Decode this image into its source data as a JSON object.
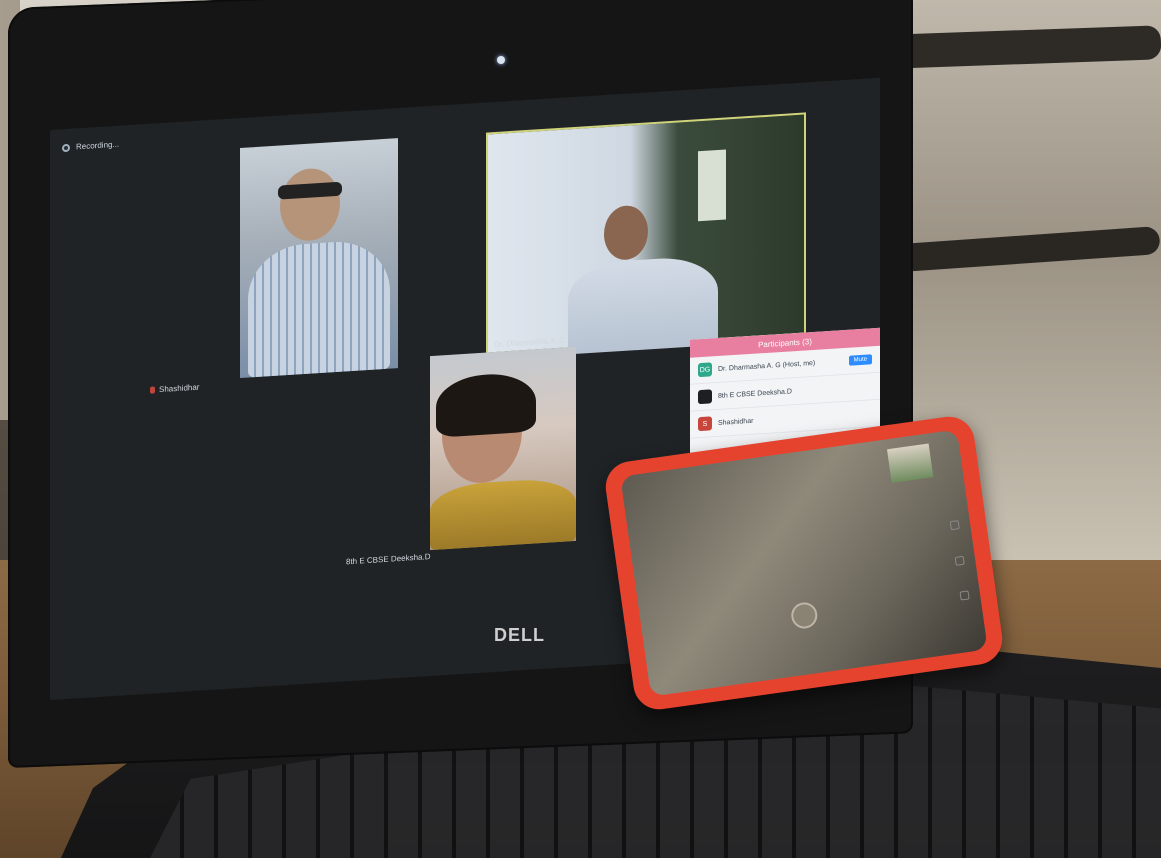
{
  "screen": {
    "recording_label": "Recording...",
    "tiles": [
      {
        "label": "Shashidhar"
      },
      {
        "label": "Dr. Dharmasha A. G"
      },
      {
        "label": "8th E CBSE Deeksha.D"
      }
    ],
    "participants_panel": {
      "title": "Participants (3)",
      "rows": [
        {
          "initials": "DG",
          "name": "Dr. Dharmasha A. G (Host, me)",
          "action": "Mute",
          "color": "#2da88a"
        },
        {
          "initials": "",
          "name": "8th E CBSE Deeksha.D",
          "action": "",
          "color": "#1d1f22"
        },
        {
          "initials": "S",
          "name": "Shashidhar",
          "action": "",
          "color": "#c8453b"
        }
      ]
    }
  },
  "laptop": {
    "brand": "DELL"
  },
  "colors": {
    "phone_case": "#e6432f",
    "screen_bg": "#1f2326",
    "highlight_border": "#cfd37a"
  }
}
